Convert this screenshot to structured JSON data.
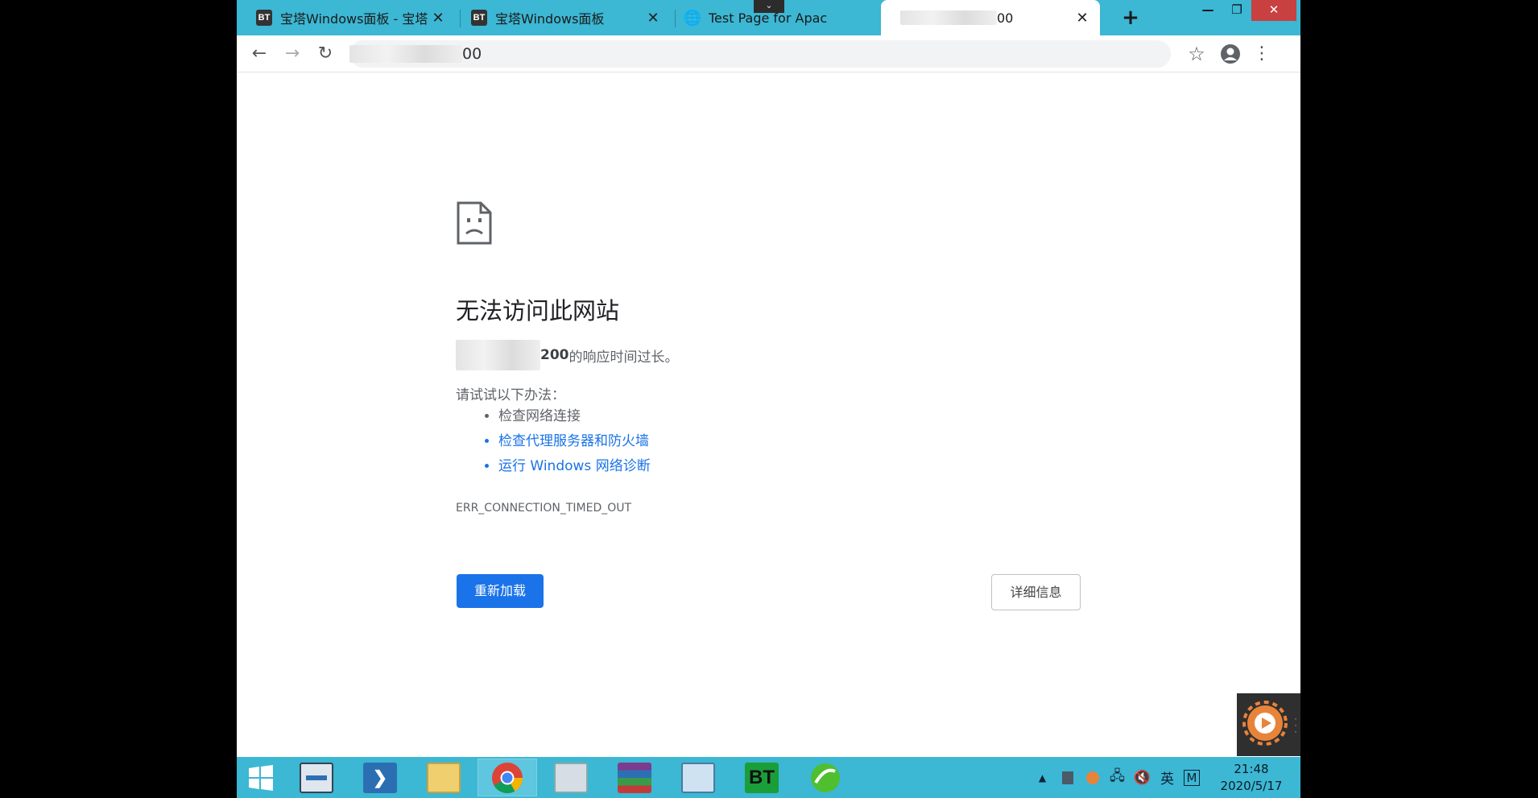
{
  "tabs": [
    {
      "favicon": "BT",
      "title": "宝塔Windows面板 - 宝塔",
      "close": "✕"
    },
    {
      "favicon": "BT",
      "title": "宝塔Windows面板",
      "close": "✕"
    },
    {
      "favicon": "globe-icon",
      "title": "Test Page for Apac",
      "close": ""
    },
    {
      "favicon": "",
      "title": "00",
      "close": "✕",
      "active": true
    }
  ],
  "tabstrip": {
    "new_tab": "+",
    "tab_search": "⌄"
  },
  "window_controls": {
    "minimize": "—",
    "restore": "❐",
    "close": "✕"
  },
  "toolbar": {
    "back": "←",
    "forward": "→",
    "reload": "↻",
    "address_suffix": "00",
    "star": "☆",
    "menu": "⋮"
  },
  "error": {
    "title": "无法访问此网站",
    "host_suffix": "200",
    "host_message": " 的响应时间过长。",
    "try_label": "请试试以下办法：",
    "suggestions": [
      "检查网络连接",
      "检查代理服务器和防火墙",
      "运行 Windows 网络诊断"
    ],
    "code": "ERR_CONNECTION_TIMED_OUT",
    "reload_label": "重新加载",
    "details_label": "详细信息"
  },
  "taskbar": {
    "items": [
      "start-icon",
      "server-manager-icon",
      "powershell-icon",
      "file-explorer-icon",
      "chrome-icon",
      "photo-viewer-icon",
      "winrar-icon",
      "control-panel-icon",
      "bt-panel-icon",
      "green-app-icon"
    ],
    "bt_label": "BT",
    "tray": {
      "arrow": "▲",
      "ime": "英",
      "m": "M"
    },
    "time": "21:48",
    "date": "2020/5/17"
  },
  "colors": {
    "accent": "#1a73e8",
    "taskbar": "#3cb7d4",
    "close": "#c94040"
  }
}
